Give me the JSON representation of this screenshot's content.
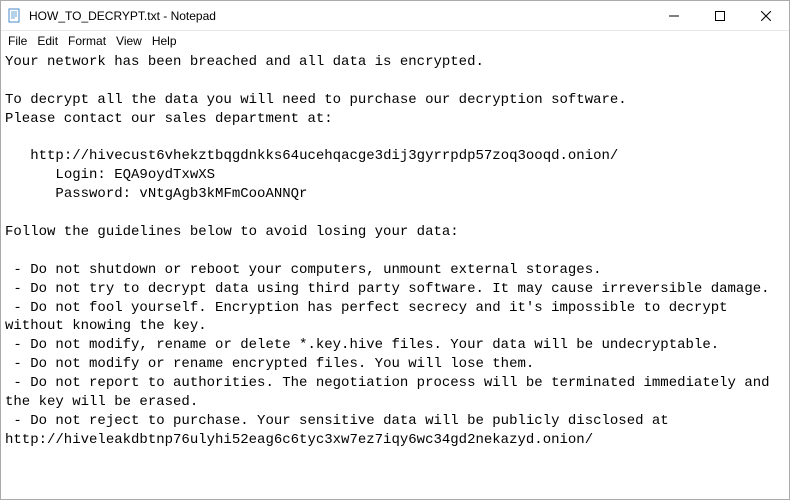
{
  "titlebar": {
    "title": "HOW_TO_DECRYPT.txt - Notepad"
  },
  "menu": {
    "file": "File",
    "edit": "Edit",
    "format": "Format",
    "view": "View",
    "help": "Help"
  },
  "content": {
    "text": "Your network has been breached and all data is encrypted.\n\nTo decrypt all the data you will need to purchase our decryption software.\nPlease contact our sales department at:\n\n   http://hivecust6vhekztbqgdnkks64ucehqacge3dij3gyrrpdp57zoq3ooqd.onion/\n      Login: EQA9oydTxwXS\n      Password: vNtgAgb3kMFmCooANNQr\n\nFollow the guidelines below to avoid losing your data:\n\n - Do not shutdown or reboot your computers, unmount external storages.\n - Do not try to decrypt data using third party software. It may cause irreversible damage.\n - Do not fool yourself. Encryption has perfect secrecy and it's impossible to decrypt without knowing the key.\n - Do not modify, rename or delete *.key.hive files. Your data will be undecryptable.\n - Do not modify or rename encrypted files. You will lose them.\n - Do not report to authorities. The negotiation process will be terminated immediately and the key will be erased.\n - Do not reject to purchase. Your sensitive data will be publicly disclosed at http://hiveleakdbtnp76ulyhi52eag6c6tyc3xw7ez7iqy6wc34gd2nekazyd.onion/"
  }
}
